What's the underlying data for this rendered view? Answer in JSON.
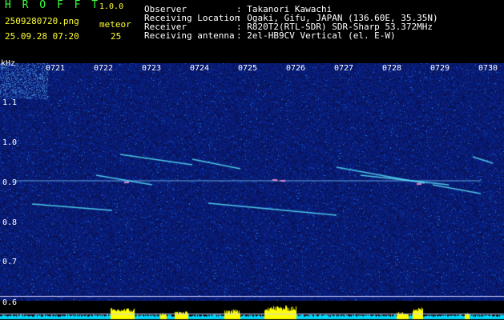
{
  "header": {
    "app_title": "H R O F F T",
    "app_version": "1.0.0",
    "file_name": "2509280720.png",
    "meteor_label": "meteor",
    "date_time": "25.09.28 07:20",
    "meteor_count": "25",
    "info": [
      {
        "label": "Observer",
        "value": ": Takanori Kawachi"
      },
      {
        "label": "Receiving Location",
        "value": ": Ogaki, Gifu, JAPAN (136.60E, 35.35N)"
      },
      {
        "label": "Receiver",
        "value": ": R820T2(RTL-SDR) SDR-Sharp 53.372MHz"
      },
      {
        "label": "Receiving antenna",
        "value": ": 2el-HB9CV Vertical (el. E-W)"
      }
    ]
  },
  "axes": {
    "y_unit": "kHz",
    "y_ticks": [
      "1.1",
      "1.0",
      "0.9",
      "0.8",
      "0.7",
      "0.6"
    ],
    "x_ticks": [
      "0721",
      "0722",
      "0723",
      "0724",
      "0725",
      "0726",
      "0727",
      "0728",
      "0729",
      "0730"
    ]
  },
  "colors": {
    "background": "#000000",
    "spectrogram_base": "#0a1064",
    "text_green": "#3cff3c",
    "text_yellow": "#ffff32",
    "signal_cyan": "#00ffff",
    "signal_yellow": "#ffff00"
  }
}
